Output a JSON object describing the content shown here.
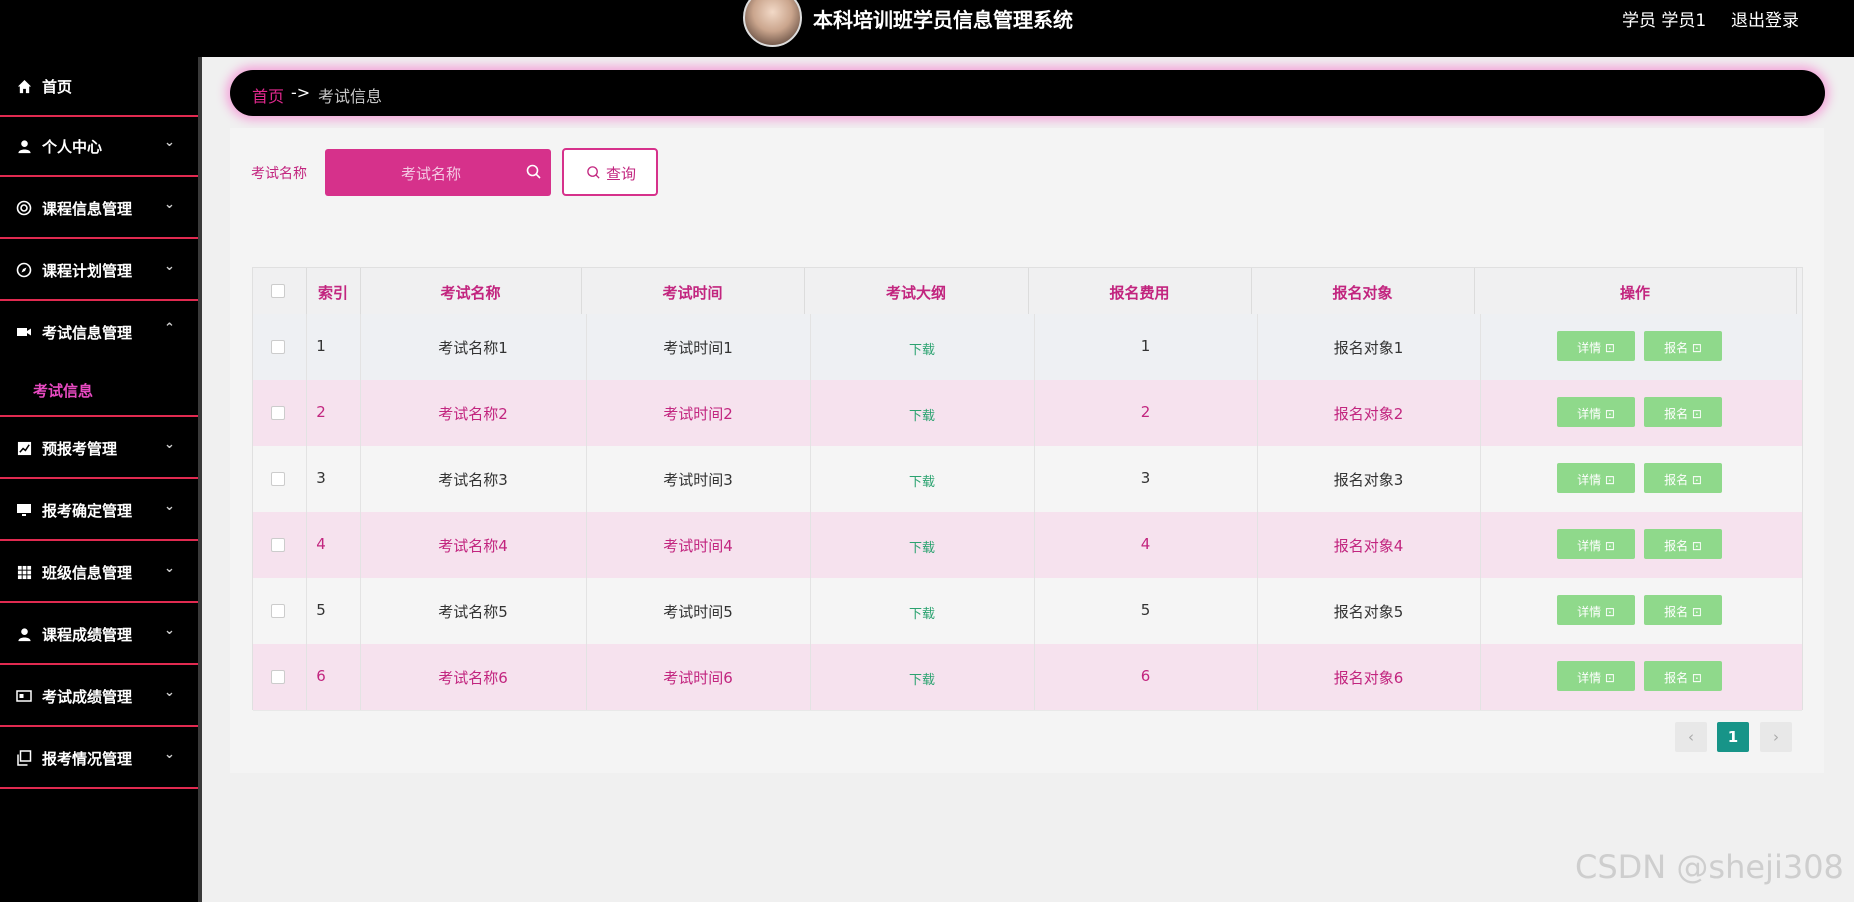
{
  "header": {
    "title": "本科培训班学员信息管理系统",
    "user": "学员 学员1",
    "logout": "退出登录"
  },
  "sidebar": {
    "items": [
      {
        "label": "首页",
        "icon": "home-icon"
      },
      {
        "label": "个人中心",
        "icon": "user-icon"
      },
      {
        "label": "课程信息管理",
        "icon": "settings-icon"
      },
      {
        "label": "课程计划管理",
        "icon": "compass-icon"
      },
      {
        "label": "考试信息管理",
        "icon": "video-icon"
      },
      {
        "label": "预报考管理",
        "icon": "chart-icon"
      },
      {
        "label": "报考确定管理",
        "icon": "monitor-icon"
      },
      {
        "label": "班级信息管理",
        "icon": "grid-icon"
      },
      {
        "label": "课程成绩管理",
        "icon": "person-icon"
      },
      {
        "label": "考试成绩管理",
        "icon": "card-icon"
      },
      {
        "label": "报考情况管理",
        "icon": "copy-icon"
      }
    ],
    "sub_item": "考试信息"
  },
  "breadcrumb": {
    "home": "首页",
    "arrow": "->",
    "current": "考试信息"
  },
  "search": {
    "label": "考试名称",
    "placeholder": "考试名称",
    "button": "查询"
  },
  "table": {
    "headers": [
      "索引",
      "考试名称",
      "考试时间",
      "考试大纲",
      "报名费用",
      "报名对象",
      "操作"
    ],
    "rows": [
      {
        "index": "1",
        "name": "考试名称1",
        "time": "考试时间1",
        "outline": "下载",
        "fee": "1",
        "target": "报名对象1"
      },
      {
        "index": "2",
        "name": "考试名称2",
        "time": "考试时间2",
        "outline": "下载",
        "fee": "2",
        "target": "报名对象2"
      },
      {
        "index": "3",
        "name": "考试名称3",
        "time": "考试时间3",
        "outline": "下载",
        "fee": "3",
        "target": "报名对象3"
      },
      {
        "index": "4",
        "name": "考试名称4",
        "time": "考试时间4",
        "outline": "下载",
        "fee": "4",
        "target": "报名对象4"
      },
      {
        "index": "5",
        "name": "考试名称5",
        "time": "考试时间5",
        "outline": "下载",
        "fee": "5",
        "target": "报名对象5"
      },
      {
        "index": "6",
        "name": "考试名称6",
        "time": "考试时间6",
        "outline": "下载",
        "fee": "6",
        "target": "报名对象6"
      }
    ],
    "detail_btn": "详情 ⊡",
    "signup_btn": "报名 ⊡"
  },
  "pagination": {
    "prev": "‹",
    "current": "1",
    "next": "›"
  },
  "watermark": "CSDN @sheji308",
  "colors": {
    "accent": "#d6318b",
    "sidebar_divider": "#e02a50",
    "action_button": "#8fd98b",
    "page_current": "#179488"
  }
}
